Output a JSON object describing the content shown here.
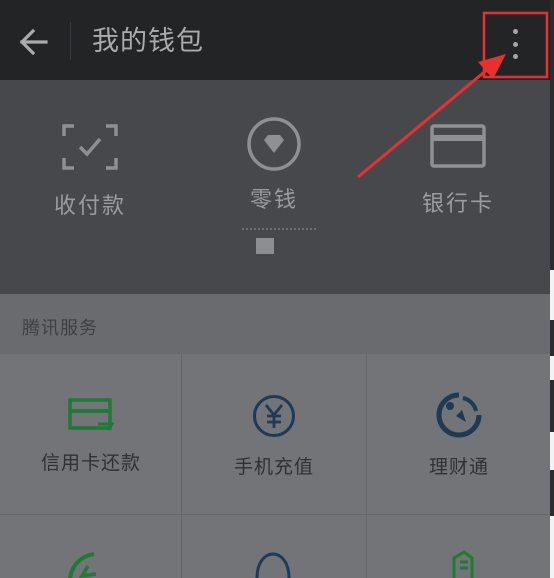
{
  "topbar": {
    "title": "我的钱包",
    "back_icon": "arrow-left-icon",
    "more_icon": "more-vertical-icon"
  },
  "wallet": {
    "items": [
      {
        "label": "收付款",
        "icon": "scan-check-icon"
      },
      {
        "label": "零钱",
        "icon": "diamond-circle-icon"
      },
      {
        "label": "银行卡",
        "icon": "bank-card-icon"
      }
    ]
  },
  "services": {
    "section_title": "腾讯服务",
    "items": [
      {
        "label": "信用卡还款",
        "icon": "credit-card-repay-icon"
      },
      {
        "label": "手机充值",
        "icon": "yen-circle-icon"
      },
      {
        "label": "理财通",
        "icon": "wealth-icon"
      }
    ]
  },
  "colors": {
    "topbar_bg": "#232426",
    "panel_bg": "#46484b",
    "grid_bg": "#727477",
    "accent_green": "#1f7a36",
    "accent_blue": "#1e3a56",
    "annotation_red": "#e8312f"
  }
}
